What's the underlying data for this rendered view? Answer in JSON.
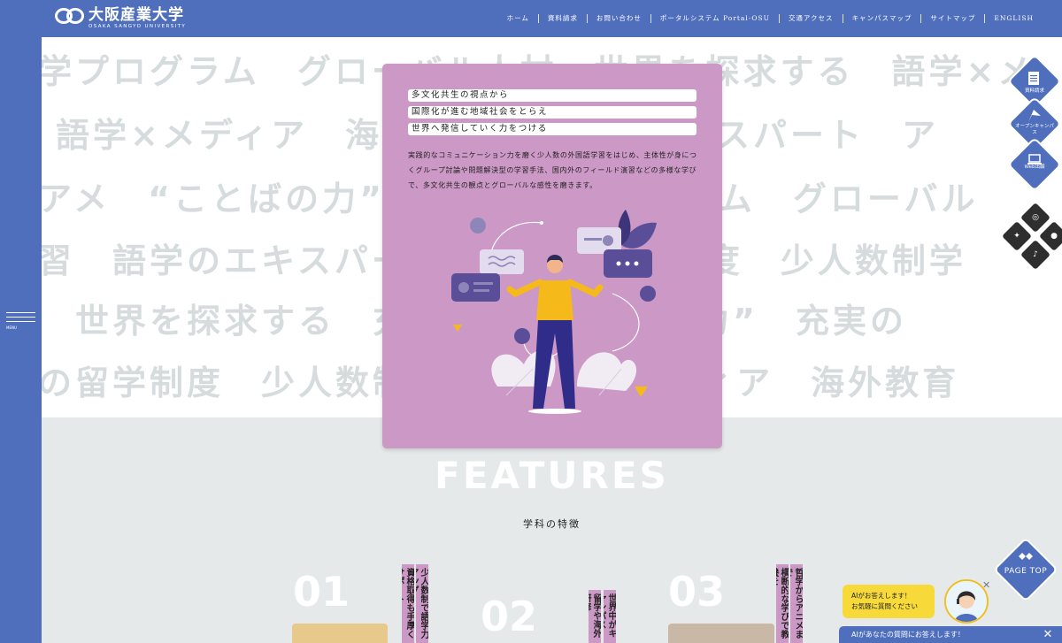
{
  "logo": {
    "jp": "大阪産業大学",
    "en": "OSAKA SANGYO UNIVERSITY"
  },
  "nav": [
    "ホーム",
    "資料請求",
    "お問い合わせ",
    "ポータルシステム Portal-OSU",
    "交通アクセス",
    "キャンパスマップ",
    "サイトマップ",
    "ENGLISH"
  ],
  "menu_label": "MENU",
  "bg_lines": [
    "学プログラム　グローバル人材　世界を探求する　語学×メ",
    "語学×メディア　海外教育　語学のエキスパート　ア",
    "アメ　“ことばの力”　充実の　プログラム　グローバル",
    "習　語学のエキスパート　充実の留学制度　少人数制学",
    "　世界を探求する　充実の　“ことばの力”　充実の",
    "の留学制度　少人数制学習　語学×メディア　海外教育"
  ],
  "card": {
    "headlines": [
      "多文化共生の視点から",
      "国際化が進む地域社会をとらえ",
      "世界へ発信していく力をつける"
    ],
    "desc": "実践的なコミュニケーション力を磨く少人数の外国語学習をはじめ、主体性が身につくグループ討論や問題解決型の学習手法、国内外のフィールド演習などの多様な学びで、多文化共生の観点とグローバルな感性を磨きます。"
  },
  "features": {
    "title": "FEATURES",
    "subtitle": "学科の特徴"
  },
  "feature_items": [
    {
      "num": "01",
      "tags": [
        "資格取得も手厚くサポート",
        "少人数制で語学力アップ"
      ]
    },
    {
      "num": "02",
      "tags": [
        "留学や海外研修",
        "世界中がキャンパス"
      ]
    },
    {
      "num": "03",
      "tags": [
        "横断的な学びで教養を",
        "哲学からアニメまで"
      ]
    }
  ],
  "side_buttons": [
    {
      "label": "資料請求",
      "icon": "document-icon"
    },
    {
      "label": "オープンキャンパス",
      "icon": "flag-icon"
    },
    {
      "label": "Web出願",
      "icon": "laptop-icon"
    }
  ],
  "social": [
    {
      "name": "instagram",
      "glyph": "◎"
    },
    {
      "name": "twitter",
      "glyph": "✦"
    },
    {
      "name": "line",
      "glyph": "●"
    },
    {
      "name": "tiktok",
      "glyph": "♪"
    }
  ],
  "page_top": "PAGE TOP",
  "ai": {
    "bubble_line1": "AIがお答えします！",
    "bubble_line2": "お気軽に質問ください",
    "bar_text": "AIがあなたの質問にお答えします！",
    "close": "✕"
  },
  "colors": {
    "brand": "#4f6fbd",
    "card": "#cc98c5",
    "bubble": "#f7d93a"
  }
}
